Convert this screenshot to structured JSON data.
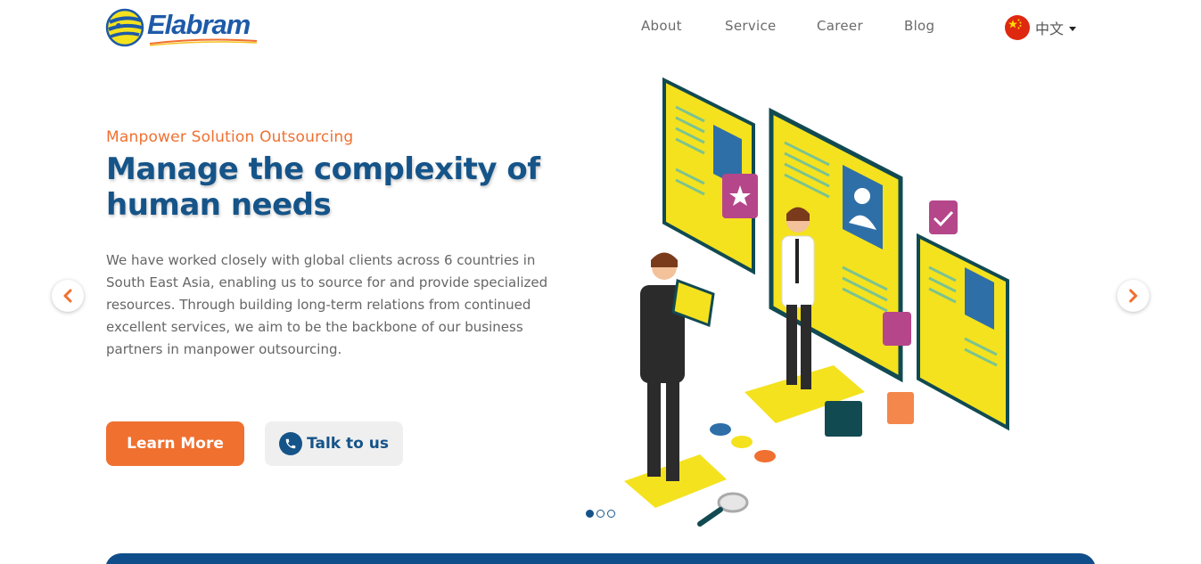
{
  "brand": {
    "name": "Elabram",
    "colors": {
      "primary": "#155489",
      "accent": "#f07030",
      "logo_yellow": "#f4e21f"
    }
  },
  "nav": {
    "items": [
      {
        "label": "About"
      },
      {
        "label": "Service"
      },
      {
        "label": "Career"
      },
      {
        "label": "Blog"
      }
    ],
    "language": {
      "label": "中文",
      "icon": "china-flag-icon"
    }
  },
  "hero": {
    "eyebrow": "Manpower Solution Outsourcing",
    "headline": "Manage the complexity of human needs",
    "description": "We have worked closely with global clients across 6 countries in South East Asia, enabling us to source for and provide specialized resources. Through building long-term relations from continued excellent services, we aim to be the backbone of our business partners in manpower outsourcing.",
    "primary_button": "Learn More",
    "secondary_button": "Talk to us",
    "secondary_icon": "phone-icon"
  },
  "carousel": {
    "prev_icon": "chevron-left-icon",
    "next_icon": "chevron-right-icon",
    "slides_total": 3,
    "active_slide": 1
  }
}
